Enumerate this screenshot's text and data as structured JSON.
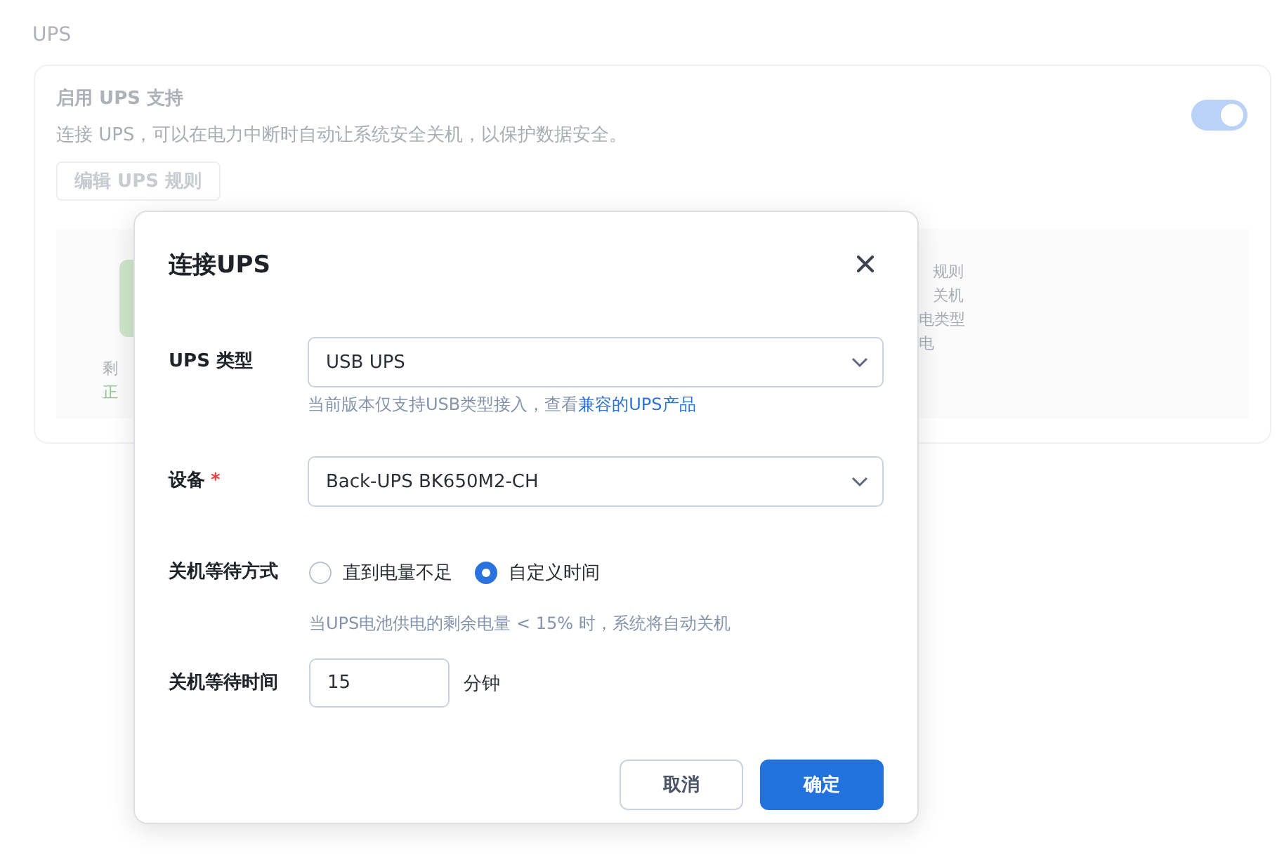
{
  "page": {
    "title": "UPS",
    "card": {
      "title": "启用 UPS 支持",
      "description": "连接 UPS，可以在电力中断时自动让系统安全关机，以保护数据安全。",
      "enabled": true,
      "edit_button": "编辑 UPS 规则",
      "panel_left": [
        {
          "text": "剩",
          "kind": "label"
        },
        {
          "text": "正",
          "kind": "status"
        }
      ],
      "panel_right": [
        {
          "text": "规则",
          "kind": "cut"
        },
        {
          "text": "关机",
          "kind": "cut"
        },
        {
          "text": "电类型",
          "kind": "edge"
        },
        {
          "text": "电",
          "kind": "edge"
        }
      ]
    }
  },
  "dialog": {
    "title": "连接UPS",
    "fields": [
      {
        "label": "UPS 类型",
        "kind": "select",
        "value": "USB UPS",
        "hint": "当前版本仅支持USB类型接入，查看",
        "hint_link": "兼容的UPS产品"
      },
      {
        "label": "设备",
        "kind": "select",
        "required_mark": "*",
        "value": "Back-UPS BK650M2-CH"
      },
      {
        "label": "关机等待方式",
        "kind": "radio",
        "options": [
          {
            "label": "直到电量不足",
            "selected": false
          },
          {
            "label": "自定义时间",
            "selected": true
          }
        ],
        "hint": "当UPS电池供电的剩余电量 < 15% 时，系统将自动关机"
      },
      {
        "label": "关机等待时间",
        "kind": "number",
        "value": "15",
        "unit": "分钟"
      }
    ],
    "buttons": [
      {
        "label": "取消",
        "kind": "secondary"
      },
      {
        "label": "确定",
        "kind": "primary"
      }
    ]
  }
}
